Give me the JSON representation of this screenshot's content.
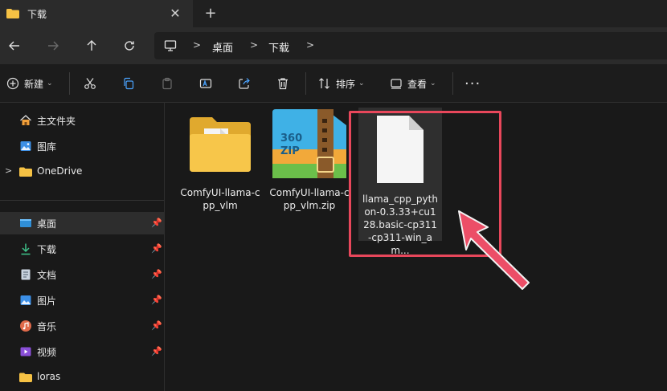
{
  "tab": {
    "title": "下载",
    "close_icon": "close-icon",
    "new_tab_icon": "plus-icon"
  },
  "nav": {
    "breadcrumbs": [
      "桌面",
      "下载"
    ]
  },
  "toolbar": {
    "new_label": "新建",
    "sort_label": "排序",
    "view_label": "查看"
  },
  "sidebar": {
    "items": [
      {
        "label": "主文件夹",
        "icon": "home-icon"
      },
      {
        "label": "图库",
        "icon": "gallery-icon"
      },
      {
        "label": "OneDrive",
        "icon": "folder-icon"
      },
      {
        "label": "桌面",
        "icon": "desktop-icon"
      },
      {
        "label": "下载",
        "icon": "download-icon"
      },
      {
        "label": "文档",
        "icon": "document-icon"
      },
      {
        "label": "图片",
        "icon": "pictures-icon"
      },
      {
        "label": "音乐",
        "icon": "music-icon"
      },
      {
        "label": "视频",
        "icon": "video-icon"
      },
      {
        "label": "loras",
        "icon": "folder-icon"
      }
    ]
  },
  "files": [
    {
      "name": "ComfyUI-llama-cpp_vlm",
      "icon": "folder-icon"
    },
    {
      "name": "ComfyUI-llama-cpp_vlm.zip",
      "icon": "zip-archive-icon",
      "badge": "360 ZIP"
    },
    {
      "name": "llama_cpp_python-0.3.33+cu128.basic-cp311-cp311-win_am...",
      "icon": "file-icon"
    }
  ],
  "colors": {
    "highlight": "#e8475b",
    "folder": "#f6c244",
    "accent": "#4aa3ff"
  }
}
